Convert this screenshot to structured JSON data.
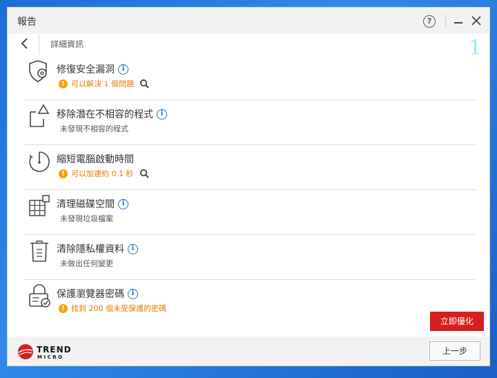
{
  "window": {
    "title": "報告"
  },
  "titlebar": {
    "help_glyph": "?"
  },
  "nav": {
    "title": "詳細資訊"
  },
  "watermark": {
    "text": "1"
  },
  "items": [
    {
      "title": "修復安全漏洞",
      "sub": "可以解決 1 個問題",
      "status": "warning",
      "icon": "shield-gear-icon"
    },
    {
      "title": "移除潛在不相容的程式",
      "sub": "未發現不相容的程式",
      "status": "ok",
      "icon": "document-warning-icon"
    },
    {
      "title": "縮短電腦啟動時間",
      "sub": "可以加速約 0.1 秒",
      "status": "warning",
      "icon": "timer-icon"
    },
    {
      "title": "清理磁碟空間",
      "sub": "未發現垃圾檔案",
      "status": "ok",
      "icon": "grid-disk-icon"
    },
    {
      "title": "清除隱私權資料",
      "sub": "未做出任何變更",
      "status": "ok",
      "icon": "trash-icon"
    },
    {
      "title": "保護瀏覽器密碼",
      "sub": "找到 200 個未受保護的密碼",
      "status": "warning",
      "icon": "lock-check-icon"
    }
  ],
  "glyphs": {
    "info": "i",
    "warn": "!"
  },
  "actions": {
    "optimize_label": "立即優化",
    "back_label": "上一步"
  },
  "logo": {
    "word1": "TREND",
    "word2": "MICRO"
  },
  "colors": {
    "accent_red": "#d81e1e",
    "warning_orange": "#e07c00",
    "info_blue": "#1a73c9"
  }
}
